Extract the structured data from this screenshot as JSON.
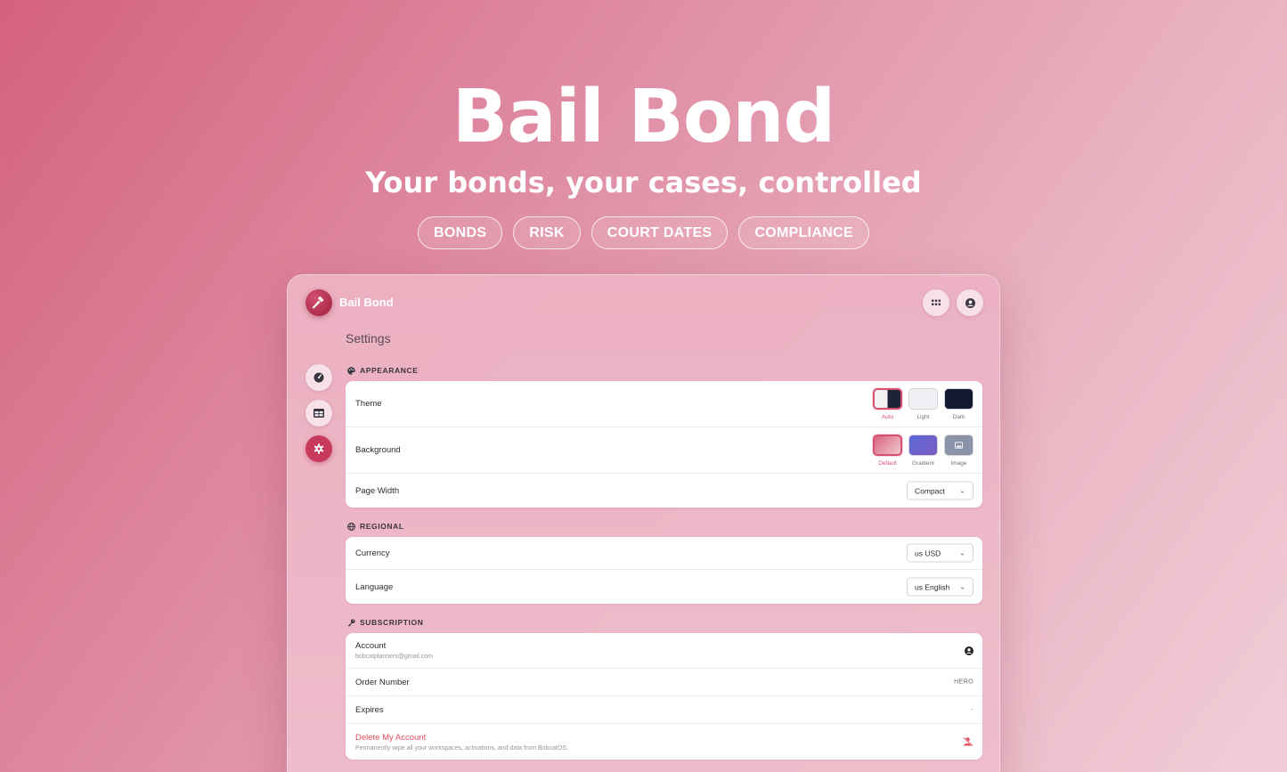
{
  "hero": {
    "title": "Bail Bond",
    "subtitle": "Your bonds, your cases, controlled",
    "pills": [
      "BONDS",
      "RISK",
      "COURT DATES",
      "COMPLIANCE"
    ]
  },
  "app": {
    "name": "Bail Bond",
    "page_title": "Settings",
    "logo_icon": "gavel-icon",
    "top_icons": [
      "apps-grid-icon",
      "account-circle-icon"
    ],
    "sidebar_icons": [
      "dashboard-gauge-icon",
      "table-icon",
      "settings-gear-icon"
    ],
    "active_sidebar": "settings",
    "accent_color": "#c83a5b"
  },
  "appearance": {
    "heading": "APPEARANCE",
    "theme": {
      "label": "Theme",
      "options": [
        "Auto",
        "Light",
        "Dark"
      ],
      "selected": "Auto"
    },
    "background": {
      "label": "Background",
      "options": [
        "Default",
        "Gradient",
        "Image"
      ],
      "selected": "Default"
    },
    "page_width": {
      "label": "Page Width",
      "value": "Compact"
    }
  },
  "regional": {
    "heading": "REGIONAL",
    "currency": {
      "label": "Currency",
      "value": "us USD"
    },
    "language": {
      "label": "Language",
      "value": "us English"
    }
  },
  "subscription": {
    "heading": "SUBSCRIPTION",
    "account": {
      "label": "Account",
      "email": "bobcatplanners@gmail.com"
    },
    "order_number": {
      "label": "Order Number",
      "value": "HERO"
    },
    "expires": {
      "label": "Expires",
      "value": "-"
    },
    "delete": {
      "label": "Delete My Account",
      "description": "Permanently wipe all your workspaces, activations, and data from BobcatOS."
    }
  }
}
